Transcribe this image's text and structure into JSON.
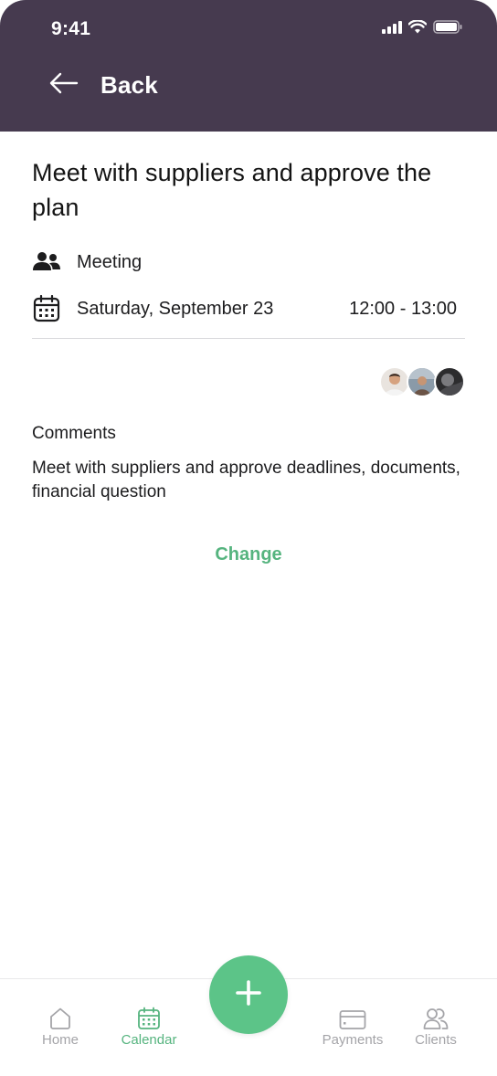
{
  "status_bar": {
    "time": "9:41"
  },
  "header": {
    "back_label": "Back"
  },
  "event": {
    "title": "Meet with suppliers and approve the plan",
    "type": "Meeting",
    "date": "Saturday, September 23",
    "time_range": "12:00 - 13:00",
    "participants": [
      "avatar-1",
      "avatar-2",
      "avatar-3"
    ]
  },
  "comments": {
    "label": "Comments",
    "text": "Meet with suppliers and approve deadlines, documents, financial question"
  },
  "actions": {
    "change_label": "Change"
  },
  "tabbar": {
    "items": [
      {
        "label": "Home",
        "icon": "home-icon"
      },
      {
        "label": "Calendar",
        "icon": "calendar-icon",
        "active": true
      },
      {
        "label": "Payments",
        "icon": "credit-card-icon"
      },
      {
        "label": "Clients",
        "icon": "users-icon"
      }
    ],
    "fab_icon": "plus-icon"
  },
  "colors": {
    "header_bg": "#463a4f",
    "accent": "#56b47f",
    "fab": "#5cc488",
    "inactive_tab": "#a4a4a8"
  }
}
